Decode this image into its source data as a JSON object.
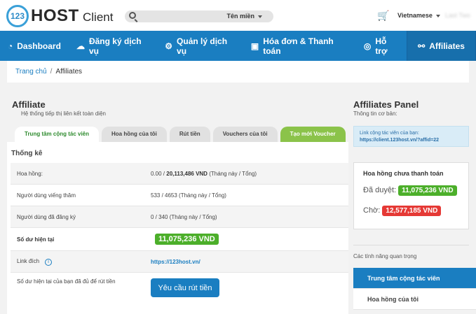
{
  "brand": {
    "logo_mark": "123",
    "name": "HOST",
    "sub": "Client"
  },
  "search": {
    "domain_select": "Tên miền"
  },
  "top": {
    "language": "Vietnamese",
    "user": "Last Two"
  },
  "nav": [
    {
      "label": "Dashboard",
      "icon": "dashboard-icon"
    },
    {
      "label": "Đăng ký dịch vụ",
      "icon": "cloud-icon"
    },
    {
      "label": "Quản lý dịch vụ",
      "icon": "gear-icon"
    },
    {
      "label": "Hóa đơn & Thanh toán",
      "icon": "money-icon"
    },
    {
      "label": "Hỗ trợ",
      "icon": "lifebuoy-icon"
    },
    {
      "label": "Affiliates",
      "icon": "link-icon"
    }
  ],
  "breadcrumb": {
    "home": "Trang chủ",
    "current": "Affiliates"
  },
  "page": {
    "title": "Affiliate",
    "subtitle": "Hệ thống tiếp thị liên kết toàn diện"
  },
  "tabs": [
    "Trung tâm cộng tác viên",
    "Hoa hồng của tôi",
    "Rút tiền",
    "Vouchers của tôi",
    "Tạo mới Voucher"
  ],
  "stats": {
    "title": "Thống kê",
    "commission_label": "Hoa hồng:",
    "commission_value_prefix": "0.00 / ",
    "commission_value_bold": "20,113,486 VND",
    "commission_value_suffix": " (Tháng này / Tổng)",
    "visitors_label": "Người dùng viếng thăm",
    "visitors_value": "533 / 4653 (Tháng này / Tổng)",
    "signups_label": "Người dùng đã đăng ký",
    "signups_value": "0 / 340 (Tháng này / Tổng)",
    "balance_label": "Số dư hiện tại",
    "balance_value": "11,075,236 VND",
    "link_label": "Link đích",
    "link_value": "https://123host.vn/",
    "withdraw_label": "Số dư hiện tại của bạn đã đủ để rút tiền",
    "withdraw_button": "Yêu cầu rút tiền"
  },
  "side": {
    "title": "Affiliates Panel",
    "subtitle": "Thông tin cơ bản:",
    "aff_link_label": "Link cộng tác viên của bạn:",
    "aff_link_value": "https://client.123host.vn/?affid=22",
    "unpaid_title": "Hoa hồng chưa thanh toán",
    "approved_label": "Đã duyệt:",
    "approved_value": "11,075,236 VND",
    "pending_label": "Chờ:",
    "pending_value": "12,577,185 VND",
    "features_label": "Các tính năng quan trọng",
    "features": [
      "Trung tâm cộng tác viên",
      "Hoa hồng của tôi"
    ]
  },
  "colors": {
    "primary": "#1a7ec1",
    "green": "#4caf2a",
    "red": "#e53935",
    "orange": "#f39c12"
  }
}
